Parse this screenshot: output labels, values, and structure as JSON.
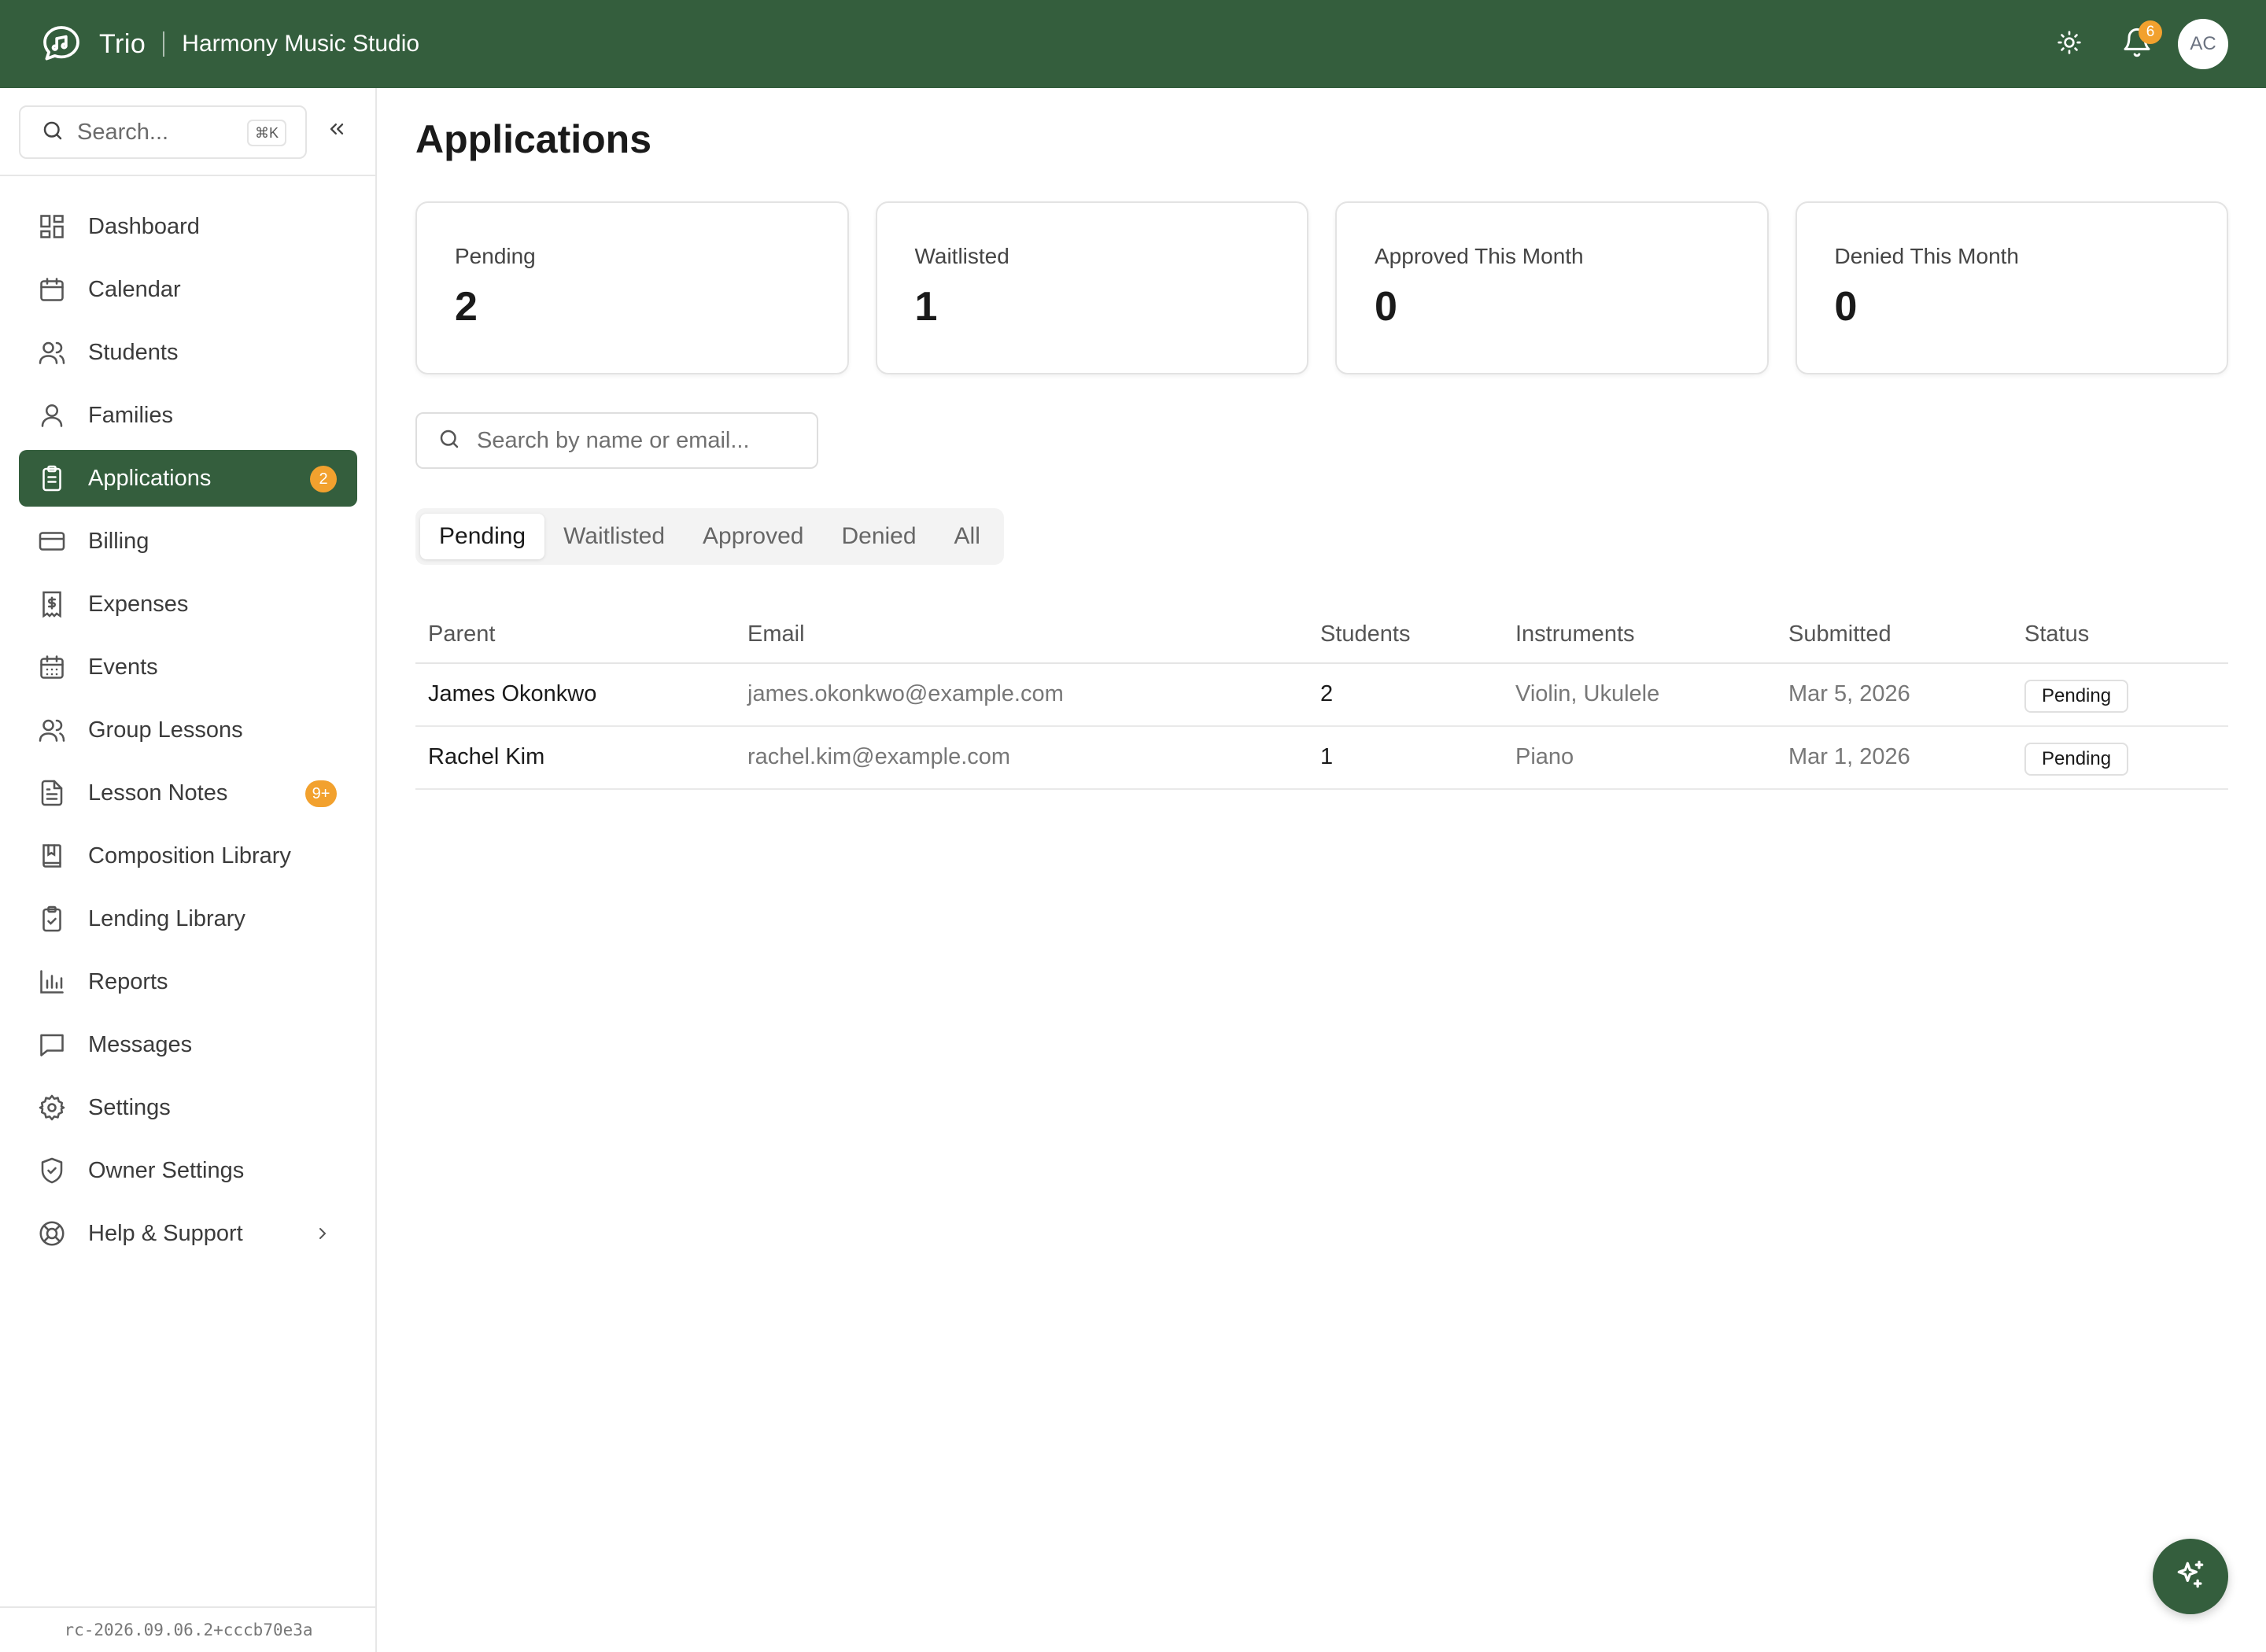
{
  "header": {
    "app_name": "Trio",
    "studio_name": "Harmony Music Studio",
    "notification_count": "6",
    "avatar_initials": "AC",
    "brand_color": "#345e3d",
    "accent_color": "#f2a12e"
  },
  "sidebar": {
    "search_placeholder": "Search...",
    "search_shortcut": "⌘K",
    "items": [
      {
        "label": "Dashboard",
        "icon": "dashboard-icon"
      },
      {
        "label": "Calendar",
        "icon": "calendar-icon"
      },
      {
        "label": "Students",
        "icon": "students-icon"
      },
      {
        "label": "Families",
        "icon": "user-icon"
      },
      {
        "label": "Applications",
        "icon": "clipboard-icon",
        "active": true,
        "badge": "2"
      },
      {
        "label": "Billing",
        "icon": "credit-card-icon"
      },
      {
        "label": "Expenses",
        "icon": "receipt-icon"
      },
      {
        "label": "Events",
        "icon": "calendar-grid-icon"
      },
      {
        "label": "Group Lessons",
        "icon": "group-icon"
      },
      {
        "label": "Lesson Notes",
        "icon": "file-text-icon",
        "badge": "9+"
      },
      {
        "label": "Composition Library",
        "icon": "book-icon"
      },
      {
        "label": "Lending Library",
        "icon": "clipboard-check-icon"
      },
      {
        "label": "Reports",
        "icon": "bar-chart-icon"
      },
      {
        "label": "Messages",
        "icon": "message-icon"
      },
      {
        "label": "Settings",
        "icon": "gear-icon"
      },
      {
        "label": "Owner Settings",
        "icon": "shield-icon"
      },
      {
        "label": "Help & Support",
        "icon": "lifebuoy-icon"
      }
    ],
    "version": "rc-2026.09.06.2+cccb70e3a"
  },
  "main": {
    "title": "Applications",
    "stats": [
      {
        "label": "Pending",
        "value": "2"
      },
      {
        "label": "Waitlisted",
        "value": "1"
      },
      {
        "label": "Approved This Month",
        "value": "0"
      },
      {
        "label": "Denied This Month",
        "value": "0"
      }
    ],
    "search_placeholder": "Search by name or email...",
    "tabs": [
      "Pending",
      "Waitlisted",
      "Approved",
      "Denied",
      "All"
    ],
    "active_tab": "Pending",
    "table": {
      "columns": [
        "Parent",
        "Email",
        "Students",
        "Instruments",
        "Submitted",
        "Status"
      ],
      "rows": [
        {
          "parent": "James Okonkwo",
          "email": "james.okonkwo@example.com",
          "students": "2",
          "instruments": "Violin, Ukulele",
          "submitted": "Mar 5, 2026",
          "status": "Pending"
        },
        {
          "parent": "Rachel Kim",
          "email": "rachel.kim@example.com",
          "students": "1",
          "instruments": "Piano",
          "submitted": "Mar 1, 2026",
          "status": "Pending"
        }
      ]
    }
  }
}
